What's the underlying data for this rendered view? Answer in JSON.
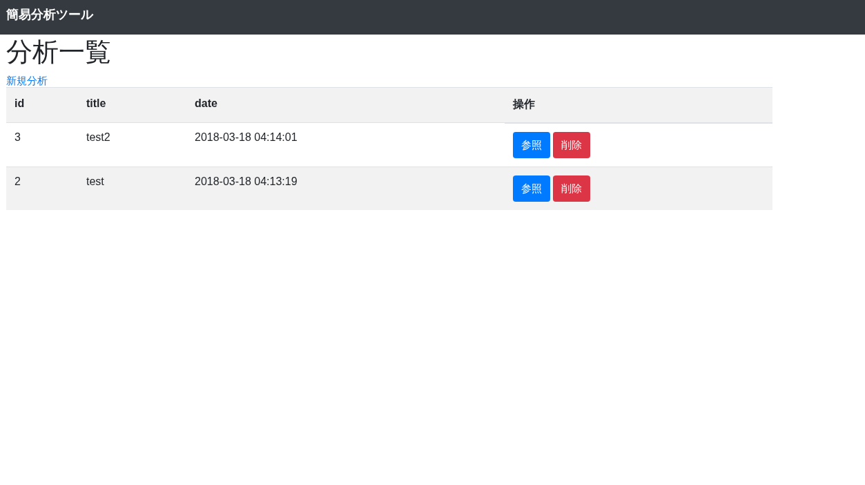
{
  "navbar": {
    "brand": "簡易分析ツール"
  },
  "page": {
    "heading": "分析一覧",
    "new_link": "新規分析"
  },
  "table": {
    "columns": [
      "id",
      "title",
      "date",
      "操作"
    ],
    "rows": [
      {
        "id": "3",
        "title": "test2",
        "date": "2018-03-18 04:14:01",
        "actions": [
          {
            "kind": "view",
            "label": "参照"
          },
          {
            "kind": "delete",
            "label": "削除"
          }
        ]
      },
      {
        "id": "2",
        "title": "test",
        "date": "2018-03-18 04:13:19",
        "actions": [
          {
            "kind": "view",
            "label": "参照"
          },
          {
            "kind": "delete",
            "label": "削除"
          }
        ]
      }
    ]
  }
}
